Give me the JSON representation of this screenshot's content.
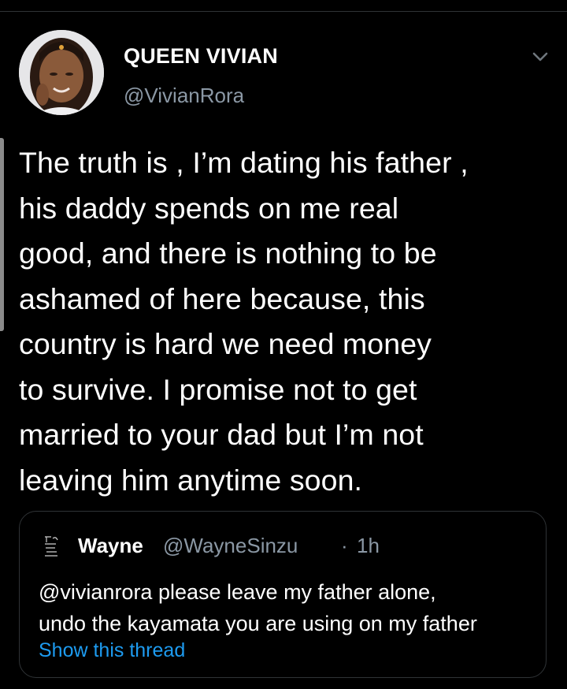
{
  "tweet": {
    "author": {
      "display_name": "QUEEN VIVIAN",
      "handle": "@VivianRora",
      "avatar_icon": "profile-photo"
    },
    "menu_icon": "chevron-down-icon",
    "text": "The truth is , I’m dating his father ,\nhis daddy spends on me real\ngood, and there is nothing to be\nashamed of here because, this\ncountry is hard we need money\nto survive.  I promise not to get\nmarried to your dad but I’m not\nleaving him anytime soon."
  },
  "quoted_tweet": {
    "author_name": "Wayne",
    "author_handle": "@WayneSinzu",
    "separator": "·",
    "time": "1h",
    "text": "@vivianrora please leave my father alone,\nundo the kayamata you are using on my father",
    "show_thread_label": "Show this thread"
  },
  "colors": {
    "background": "#000000",
    "text_primary": "#ffffff",
    "text_secondary": "#8b98a5",
    "link": "#1d9bf0",
    "border": "#2f3336"
  }
}
